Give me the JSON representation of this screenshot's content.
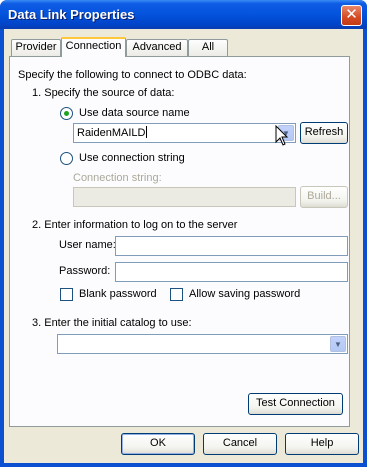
{
  "window": {
    "title": "Data Link Properties",
    "close_symbol": "✕"
  },
  "tabs": [
    {
      "label": "Provider",
      "active": false
    },
    {
      "label": "Connection",
      "active": true
    },
    {
      "label": "Advanced",
      "active": false
    },
    {
      "label": "All",
      "active": false
    }
  ],
  "connection": {
    "intro": "Specify the following to connect to ODBC data:",
    "step1": "1. Specify the source of data:",
    "radio_dsn_label": "Use data source name",
    "dsn_value": "RaidenMAILD",
    "refresh_label": "Refresh",
    "radio_connstr_label": "Use connection string",
    "connstr_label": "Connection string:",
    "connstr_value": "",
    "build_label": "Build...",
    "step2": "2. Enter information to log on to the server",
    "username_label": "User name:",
    "username_value": "",
    "password_label": "Password:",
    "password_value": "",
    "blank_password_label": "Blank password",
    "allow_saving_label": "Allow saving password",
    "step3": "3. Enter the initial catalog to use:",
    "catalog_value": "",
    "test_connection_label": "Test Connection"
  },
  "footer": {
    "ok_label": "OK",
    "cancel_label": "Cancel",
    "help_label": "Help"
  },
  "icons": {
    "dropdown": "▼",
    "selected_radio": "green-dot"
  }
}
